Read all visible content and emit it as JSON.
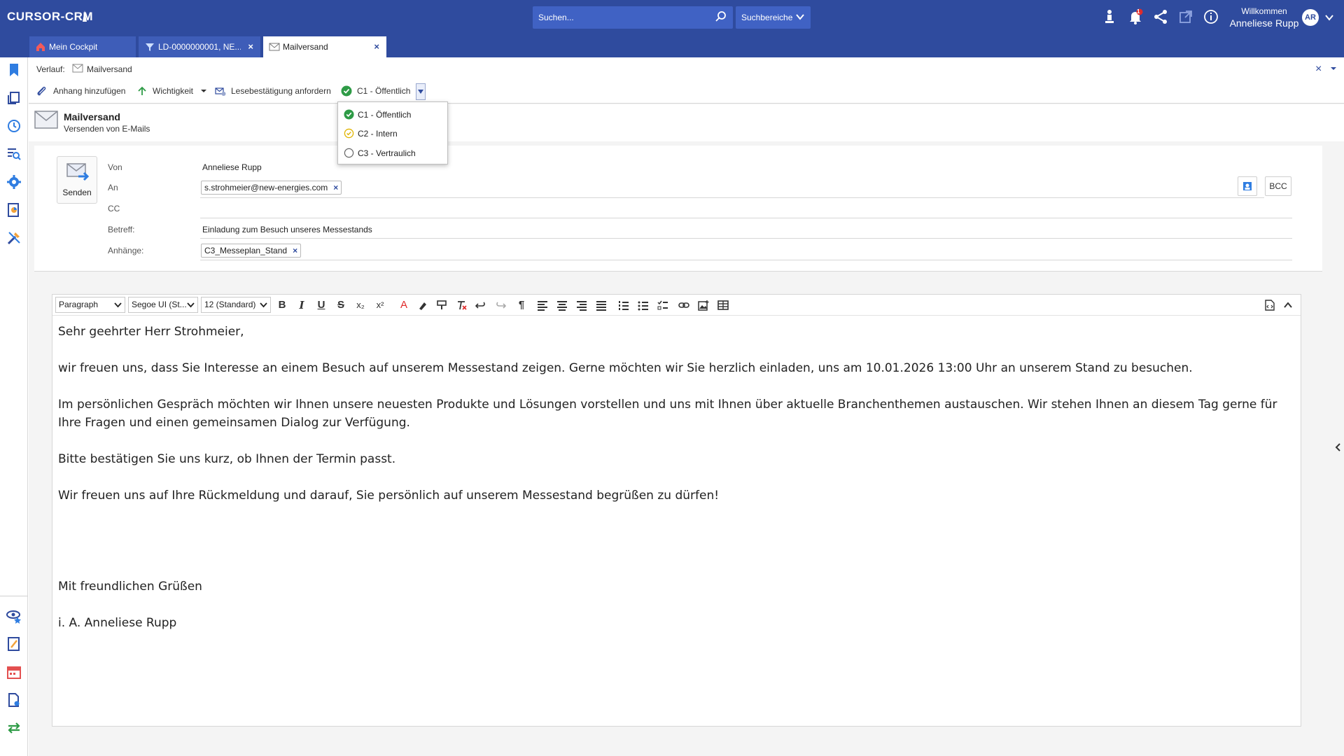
{
  "app": {
    "logo": "CURSOR-CRM"
  },
  "header": {
    "search_placeholder": "Suchen...",
    "scope_label": "Suchbereiche",
    "welcome": "Willkommen",
    "user_name": "Anneliese Rupp",
    "user_initials": "AR",
    "notification_badge": "1"
  },
  "tabs": [
    {
      "label": "Mein Cockpit",
      "icon": "home-icon"
    },
    {
      "label": "LD-0000000001, NE...",
      "icon": "funnel-icon",
      "close": "×"
    },
    {
      "label": "Mailversand",
      "icon": "mail-icon",
      "close": "×",
      "active": true
    }
  ],
  "breadcrumb": {
    "label": "Verlauf:",
    "value": "Mailversand",
    "close": "×"
  },
  "toolbar": {
    "attach": "Anhang hinzufügen",
    "priority": "Wichtigkeit",
    "read_receipt": "Lesebestätigung anfordern",
    "classification": "C1 - Öffentlich"
  },
  "classification_menu": {
    "options": [
      {
        "label": "C1 - Öffentlich",
        "state": "selected"
      },
      {
        "label": "C2 - Intern",
        "state": "hover"
      },
      {
        "label": "C3 - Vertraulich",
        "state": "none"
      }
    ]
  },
  "module": {
    "title": "Mailversand",
    "subtitle": "Versenden von E-Mails"
  },
  "form": {
    "send_label": "Senden",
    "from_label": "Von",
    "from_value": "Anneliese Rupp",
    "to_label": "An",
    "to_chip": "s.strohmeier@new-energies.com",
    "cc_label": "CC",
    "bcc_label": "BCC",
    "subject_label": "Betreff:",
    "subject_value": "Einladung zum Besuch unseres Messestands",
    "attachments_label": "Anhänge:",
    "attachment_chip": "C3_Messeplan_Stand"
  },
  "editor": {
    "block_format": "Paragraph",
    "font_family": "Segoe UI (St...",
    "font_size": "12 (Standard)",
    "body": {
      "greeting": "Sehr geehrter Herr Strohmeier,",
      "p1": "wir freuen uns, dass Sie Interesse an einem Besuch auf unserem Messestand zeigen. Gerne möchten wir Sie herzlich einladen, uns am 10.01.2026 13:00 Uhr an unserem Stand zu besuchen.",
      "p2": "Im persönlichen Gespräch möchten wir Ihnen unsere neuesten Produkte und Lösungen vorstellen und uns mit Ihnen über aktuelle Branchenthemen austauschen. Wir stehen Ihnen an diesem Tag gerne für Ihre Fragen und einen gemeinsamen Dialog zur Verfügung.",
      "p3": "Bitte bestätigen Sie uns kurz, ob Ihnen der Termin passt.",
      "p4": "Wir freuen uns auf Ihre Rückmeldung und darauf, Sie persönlich auf unserem Messestand begrüßen zu dürfen!",
      "closing": "Mit freundlichen Grüßen",
      "signature": "i. A. Anneliese Rupp"
    }
  },
  "colors": {
    "brand": "#2f4b9e",
    "brand_light": "#4062c4",
    "check_green": "#2e9b46",
    "hover_yellow": "#e0b400",
    "alert_red": "#e02b2b"
  }
}
